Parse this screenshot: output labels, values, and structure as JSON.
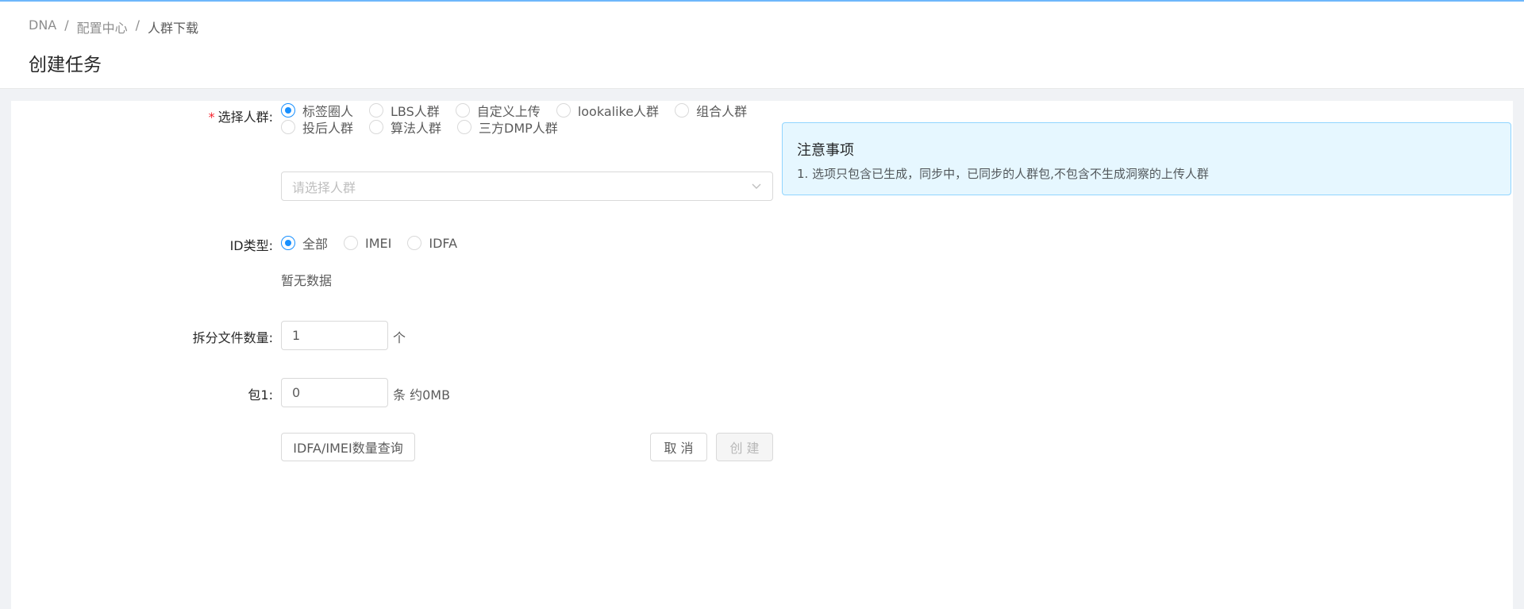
{
  "breadcrumb": [
    "DNA",
    "配置中心",
    "人群下载"
  ],
  "breadcrumb_separator": "/",
  "page_title": "创建任务",
  "form": {
    "audience": {
      "label": "选择人群:",
      "required_mark": "*",
      "options_row1": [
        "标签圈人",
        "LBS人群",
        "自定义上传",
        "lookalike人群",
        "组合人群"
      ],
      "options_row2": [
        "投后人群",
        "算法人群",
        "三方DMP人群"
      ],
      "selected": "标签圈人",
      "select_placeholder": "请选择人群"
    },
    "id_type": {
      "label": "ID类型:",
      "options": [
        "全部",
        "IMEI",
        "IDFA"
      ],
      "selected": "全部",
      "empty_text": "暂无数据"
    },
    "split_count": {
      "label": "拆分文件数量:",
      "value": "1",
      "unit": "个"
    },
    "package1": {
      "label": "包1:",
      "value": "0",
      "unit": "条 约0MB"
    }
  },
  "buttons": {
    "query": "IDFA/IMEI数量查询",
    "cancel": "取 消",
    "create": "创 建"
  },
  "notice": {
    "title": "注意事项",
    "text": "1. 选项只包含已生成，同步中，已同步的人群包,不包含不生成洞察的上传人群"
  },
  "colors": {
    "primary": "#1890ff",
    "required": "#f5222d",
    "notice_bg": "#e6f7ff",
    "notice_border": "#91d5ff"
  }
}
